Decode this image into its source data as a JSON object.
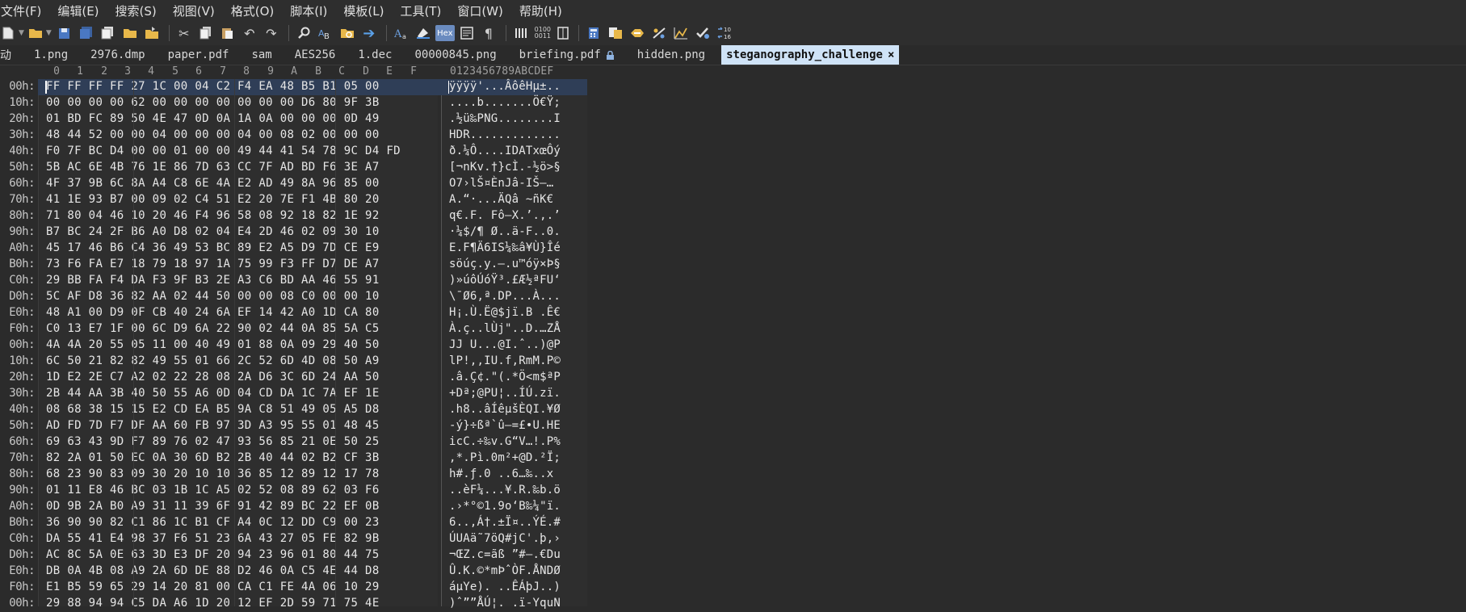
{
  "menu": [
    "文件(F)",
    "编辑(E)",
    "搜索(S)",
    "视图(V)",
    "格式(O)",
    "脚本(I)",
    "模板(L)",
    "工具(T)",
    "窗口(W)",
    "帮助(H)"
  ],
  "toolbar": {
    "hex_label": "Hex",
    "icons": [
      "new-file-icon",
      "open-folder-icon",
      "save-icon",
      "save-all-icon",
      "copy-files-icon",
      "folder-icon",
      "folder-move-icon",
      "cut-icon",
      "copy-icon",
      "paste-icon",
      "undo-icon",
      "redo-icon",
      "find-icon",
      "replace-icon",
      "find-in-files-icon",
      "goto-icon",
      "text-encoding-icon",
      "highlight-icon",
      "hex-mode-icon",
      "edit-as-icon",
      "pilcrow-icon",
      "columns-icon",
      "binary-icon",
      "calculator-icon",
      "compare-icon",
      "checksum-icon",
      "percent-icon",
      "histogram-icon",
      "validate-icon",
      "base-convert-icon"
    ]
  },
  "tabs": [
    {
      "label": "动",
      "active": false,
      "locked": false
    },
    {
      "label": "1.png",
      "active": false,
      "locked": false
    },
    {
      "label": "2976.dmp",
      "active": false,
      "locked": false
    },
    {
      "label": "paper.pdf",
      "active": false,
      "locked": false
    },
    {
      "label": "sam",
      "active": false,
      "locked": false
    },
    {
      "label": "AES256",
      "active": false,
      "locked": false
    },
    {
      "label": "1.dec",
      "active": false,
      "locked": false
    },
    {
      "label": "00000845.png",
      "active": false,
      "locked": false
    },
    {
      "label": "briefing.pdf",
      "active": false,
      "locked": true
    },
    {
      "label": "hidden.png",
      "active": false,
      "locked": false
    },
    {
      "label": "steganography_challenge",
      "active": true,
      "locked": false
    }
  ],
  "close_glyph": "×",
  "column_headers": [
    "0",
    "1",
    "2",
    "3",
    "4",
    "5",
    "6",
    "7",
    "8",
    "9",
    "A",
    "B",
    "C",
    "D",
    "E",
    "F"
  ],
  "ascii_header": "0123456789ABCDEF",
  "rows": [
    {
      "offset": "00h:",
      "hex": "FF FF FF FF 27 1C 00 04 C2 F4 EA 48 B5 B1 05 00",
      "ascii": "ÿÿÿÿ'...ÂôêHµ±..",
      "selected": true
    },
    {
      "offset": "10h:",
      "hex": "00 00 00 00 62 00 00 00 00 00 00 00 D6 80 9F 3B",
      "ascii": "....b.......Ö€Ÿ;",
      "selected": false
    },
    {
      "offset": "20h:",
      "hex": "01 BD FC 89 50 4E 47 0D 0A 1A 0A 00 00 00 0D 49",
      "ascii": ".½ü‰PNG........I",
      "selected": false
    },
    {
      "offset": "30h:",
      "hex": "48 44 52 00 00 04 00 00 00 04 00 08 02 00 00 00",
      "ascii": "HDR.............",
      "selected": false
    },
    {
      "offset": "40h:",
      "hex": "F0 7F BC D4 00 00 01 00 00 49 44 41 54 78 9C D4 FD",
      "ascii": "ð.¼Ô....IDATxœÔý",
      "selected": false
    },
    {
      "offset": "50h:",
      "hex": "5B AC 6E 4B 76 1E 86 7D 63 CC 7F AD BD F6 3E A7",
      "ascii": "[¬nKv.†}cÌ.-½ö>§",
      "selected": false
    },
    {
      "offset": "60h:",
      "hex": "4F 37 9B 6C 8A A4 C8 6E 4A E2 AD 49 8A 96 85 00",
      "ascii": "O7›lŠ¤ÈnJâ-IŠ–…",
      "selected": false
    },
    {
      "offset": "70h:",
      "hex": "41 1E 93 B7 00 09 02 C4 51 E2 20 7E F1 4B 80 20",
      "ascii": "A.“·...ÄQâ ~ñK€ ",
      "selected": false
    },
    {
      "offset": "80h:",
      "hex": "71 80 04 46 10 20 46 F4 96 58 08 92 18 82 1E 92",
      "ascii": "q€.F. Fô–X.’.‚.’",
      "selected": false
    },
    {
      "offset": "90h:",
      "hex": "B7 BC 24 2F B6 A0 D8 02 04 E4 2D 46 02 09 30 10",
      "ascii": "·¼$/¶ Ø..ä-F..0.",
      "selected": false
    },
    {
      "offset": "A0h:",
      "hex": "45 17 46 B6 C4 36 49 53 BC 89 E2 A5 D9 7D CE E9",
      "ascii": "E.F¶Ä6IS¼‰â¥Ù}Îé",
      "selected": false
    },
    {
      "offset": "B0h:",
      "hex": "73 F6 FA E7 18 79 18 97 1A 75 99 F3 FF D7 DE A7",
      "ascii": "söúç.y.—.u™óÿ×Þ§",
      "selected": false
    },
    {
      "offset": "C0h:",
      "hex": "29 BB FA F4 DA F3 9F B3 2E A3 C6 BD AA 46 55 91",
      "ascii": ")»úôÚóŸ³.£Æ½ªFU‘",
      "selected": false
    },
    {
      "offset": "D0h:",
      "hex": "5C AF D8 36 82 AA 02 44 50 00 00 08 C0 00 00 10",
      "ascii": "\\¯Ø6‚ª.DP...À...",
      "selected": false
    },
    {
      "offset": "E0h:",
      "hex": "48 A1 00 D9 0F CB 40 24 6A EF 14 42 A0 1D CA 80",
      "ascii": "H¡.Ù.Ë@$jï.B .Ê€",
      "selected": false
    },
    {
      "offset": "F0h:",
      "hex": "C0 13 E7 1F 00 6C D9 6A 22 90 02 44 0A 85 5A C5",
      "ascii": "À.ç..lÙj\"..D.…ZÅ",
      "selected": false
    },
    {
      "offset": "00h:",
      "hex": "4A 4A 20 55 05 11 00 40 49 01 88 0A 09 29 40 50",
      "ascii": "JJ U...@I.ˆ..)@P",
      "selected": false
    },
    {
      "offset": "10h:",
      "hex": "6C 50 21 82 82 49 55 01 66 2C 52 6D 4D 08 50 A9",
      "ascii": "lP!‚‚IU.f,RmM.P©",
      "selected": false
    },
    {
      "offset": "20h:",
      "hex": "1D E2 2E C7 A2 02 22 28 08 2A D6 3C 6D 24 AA 50",
      "ascii": ".â.Ç¢.\"(.*Ö<m$ªP",
      "selected": false
    },
    {
      "offset": "30h:",
      "hex": "2B 44 AA 3B 40 50 55 A6 0D 04 CD DA 1C 7A EF 1E",
      "ascii": "+Dª;@PU¦..ÍÚ.zï.",
      "selected": false
    },
    {
      "offset": "40h:",
      "hex": "08 68 38 15 15 E2 CD EA B5 9A C8 51 49 05 A5 D8",
      "ascii": ".h8..âÍêµšÈQI.¥Ø",
      "selected": false
    },
    {
      "offset": "50h:",
      "hex": "AD FD 7D F7 DF AA 60 FB 97 3D A3 95 55 01 48 45",
      "ascii": "-ý}÷ßª`û—=£•U.HE",
      "selected": false
    },
    {
      "offset": "60h:",
      "hex": "69 63 43 9D F7 89 76 02 47 93 56 85 21 0E 50 25",
      "ascii": "icC.÷‰v.G“V…!.P%",
      "selected": false
    },
    {
      "offset": "70h:",
      "hex": "82 2A 01 50 EC 0A 30 6D B2 2B 40 44 02 B2 CF 3B",
      "ascii": ",*.Pì.0m²+@D.²Ï;",
      "selected": false
    },
    {
      "offset": "80h:",
      "hex": "68 23 90 83 09 30 20 10 10 36 85 12 89 12 17 78",
      "ascii": "h#.ƒ.0 ..6…‰..x",
      "selected": false
    },
    {
      "offset": "90h:",
      "hex": "01 11 E8 46 BC 03 1B 1C A5 02 52 08 89 62 03 F6",
      "ascii": "..èF¼...¥.R.‰b.ö",
      "selected": false
    },
    {
      "offset": "A0h:",
      "hex": "0D 9B 2A B0 A9 31 11 39 6F 91 42 89 BC 22 EF 0B",
      "ascii": ".›*°©1.9o‘B‰¼\"ï.",
      "selected": false
    },
    {
      "offset": "B0h:",
      "hex": "36 90 90 82 C1 86 1C B1 CF A4 0C 12 DD C9 00 23",
      "ascii": "6..‚Á†.±Ï¤..ÝÉ.#",
      "selected": false
    },
    {
      "offset": "C0h:",
      "hex": "DA 55 41 E4 98 37 F6 51 23 6A 43 27 05 FE 82 9B",
      "ascii": "ÚUAä˜7öQ#jC'.þ‚›",
      "selected": false
    },
    {
      "offset": "D0h:",
      "hex": "AC 8C 5A 0E 63 3D E3 DF 20 94 23 96 01 80 44 75",
      "ascii": "¬ŒZ.c=ãß ”#–.€Du",
      "selected": false
    },
    {
      "offset": "E0h:",
      "hex": "DB 0A 4B 08 A9 2A 6D DE 88 D2 46 0A C5 4E 44 D8",
      "ascii": "Û.K.©*mÞˆÒF.ÅNDØ",
      "selected": false
    },
    {
      "offset": "F0h:",
      "hex": "E1 B5 59 65 29 14 20 81 00 CA C1 FE 4A 06 10 29",
      "ascii": "áµYe). ..ÊÁþJ..)",
      "selected": false
    },
    {
      "offset": "00h:",
      "hex": "29 88 94 94 C5 DA A6 1D 20 12 EF 2D 59 71 75 4E",
      "ascii": ")ˆ””ÅÚ¦. .ï-YquN",
      "selected": false
    }
  ]
}
